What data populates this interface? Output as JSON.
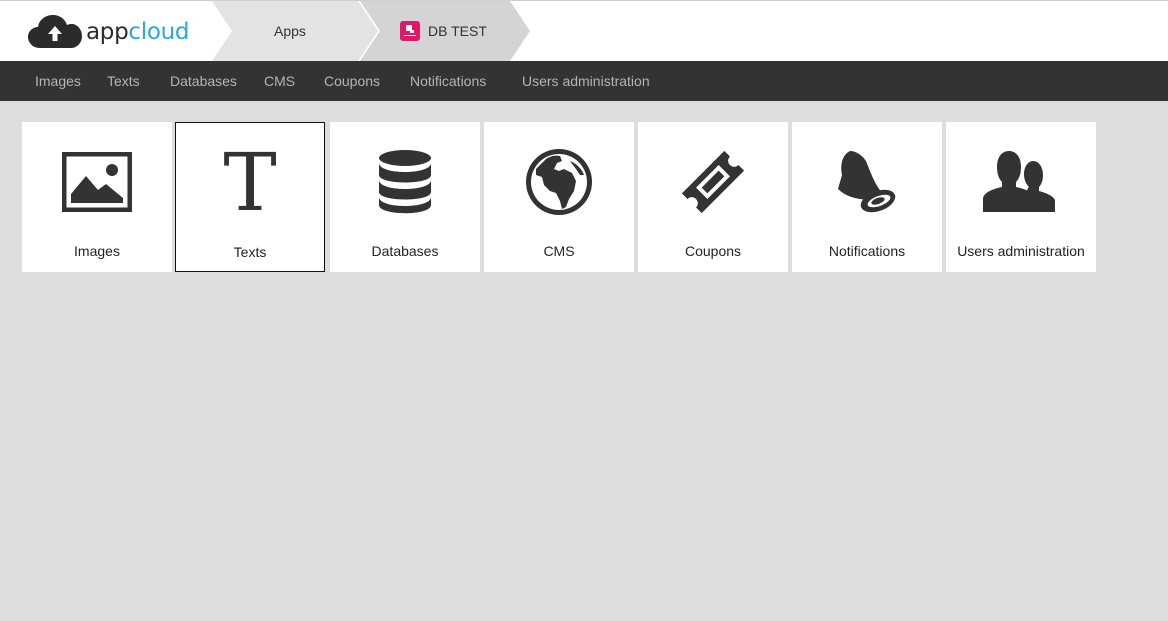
{
  "brand": {
    "part1": "app",
    "part2": "cloud",
    "accent": "#2aa8d9"
  },
  "breadcrumb": {
    "apps_label": "Apps",
    "app_label": "DB TEST",
    "app_badge_color": "#e0186c"
  },
  "nav": {
    "items": [
      "Images",
      "Texts",
      "Databases",
      "CMS",
      "Coupons",
      "Notifications",
      "Users administration"
    ]
  },
  "tiles": [
    {
      "label": "Images",
      "icon": "image-icon"
    },
    {
      "label": "Texts",
      "icon": "text-icon",
      "glyph": "T",
      "selected": true
    },
    {
      "label": "Databases",
      "icon": "database-icon"
    },
    {
      "label": "CMS",
      "icon": "globe-icon"
    },
    {
      "label": "Coupons",
      "icon": "ticket-icon"
    },
    {
      "label": "Notifications",
      "icon": "bell-icon"
    },
    {
      "label": "Users administration",
      "icon": "users-icon"
    }
  ]
}
